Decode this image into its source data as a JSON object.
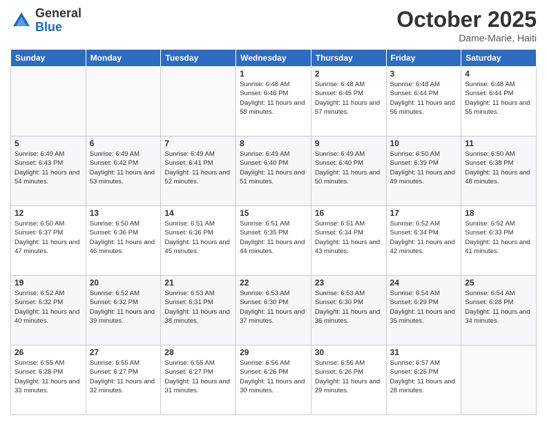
{
  "header": {
    "logo_general": "General",
    "logo_blue": "Blue",
    "month_title": "October 2025",
    "location": "Dame-Marie, Haiti"
  },
  "weekdays": [
    "Sunday",
    "Monday",
    "Tuesday",
    "Wednesday",
    "Thursday",
    "Friday",
    "Saturday"
  ],
  "weeks": [
    [
      {
        "day": "",
        "info": ""
      },
      {
        "day": "",
        "info": ""
      },
      {
        "day": "",
        "info": ""
      },
      {
        "day": "1",
        "info": "Sunrise: 6:48 AM\nSunset: 6:46 PM\nDaylight: 11 hours\nand 58 minutes."
      },
      {
        "day": "2",
        "info": "Sunrise: 6:48 AM\nSunset: 6:45 PM\nDaylight: 11 hours\nand 57 minutes."
      },
      {
        "day": "3",
        "info": "Sunrise: 6:48 AM\nSunset: 6:44 PM\nDaylight: 11 hours\nand 56 minutes."
      },
      {
        "day": "4",
        "info": "Sunrise: 6:48 AM\nSunset: 6:44 PM\nDaylight: 11 hours\nand 55 minutes."
      }
    ],
    [
      {
        "day": "5",
        "info": "Sunrise: 6:49 AM\nSunset: 6:43 PM\nDaylight: 11 hours\nand 54 minutes."
      },
      {
        "day": "6",
        "info": "Sunrise: 6:49 AM\nSunset: 6:42 PM\nDaylight: 11 hours\nand 53 minutes."
      },
      {
        "day": "7",
        "info": "Sunrise: 6:49 AM\nSunset: 6:41 PM\nDaylight: 11 hours\nand 52 minutes."
      },
      {
        "day": "8",
        "info": "Sunrise: 6:49 AM\nSunset: 6:40 PM\nDaylight: 11 hours\nand 51 minutes."
      },
      {
        "day": "9",
        "info": "Sunrise: 6:49 AM\nSunset: 6:40 PM\nDaylight: 11 hours\nand 50 minutes."
      },
      {
        "day": "10",
        "info": "Sunrise: 6:50 AM\nSunset: 6:39 PM\nDaylight: 11 hours\nand 49 minutes."
      },
      {
        "day": "11",
        "info": "Sunrise: 6:50 AM\nSunset: 6:38 PM\nDaylight: 11 hours\nand 48 minutes."
      }
    ],
    [
      {
        "day": "12",
        "info": "Sunrise: 6:50 AM\nSunset: 6:37 PM\nDaylight: 11 hours\nand 47 minutes."
      },
      {
        "day": "13",
        "info": "Sunrise: 6:50 AM\nSunset: 6:36 PM\nDaylight: 11 hours\nand 46 minutes."
      },
      {
        "day": "14",
        "info": "Sunrise: 6:51 AM\nSunset: 6:36 PM\nDaylight: 11 hours\nand 45 minutes."
      },
      {
        "day": "15",
        "info": "Sunrise: 6:51 AM\nSunset: 6:35 PM\nDaylight: 11 hours\nand 44 minutes."
      },
      {
        "day": "16",
        "info": "Sunrise: 6:51 AM\nSunset: 6:34 PM\nDaylight: 11 hours\nand 43 minutes."
      },
      {
        "day": "17",
        "info": "Sunrise: 6:52 AM\nSunset: 6:34 PM\nDaylight: 11 hours\nand 42 minutes."
      },
      {
        "day": "18",
        "info": "Sunrise: 6:52 AM\nSunset: 6:33 PM\nDaylight: 11 hours\nand 41 minutes."
      }
    ],
    [
      {
        "day": "19",
        "info": "Sunrise: 6:52 AM\nSunset: 6:32 PM\nDaylight: 11 hours\nand 40 minutes."
      },
      {
        "day": "20",
        "info": "Sunrise: 6:52 AM\nSunset: 6:32 PM\nDaylight: 11 hours\nand 39 minutes."
      },
      {
        "day": "21",
        "info": "Sunrise: 6:53 AM\nSunset: 6:31 PM\nDaylight: 11 hours\nand 38 minutes."
      },
      {
        "day": "22",
        "info": "Sunrise: 6:53 AM\nSunset: 6:30 PM\nDaylight: 11 hours\nand 37 minutes."
      },
      {
        "day": "23",
        "info": "Sunrise: 6:53 AM\nSunset: 6:30 PM\nDaylight: 11 hours\nand 36 minutes."
      },
      {
        "day": "24",
        "info": "Sunrise: 6:54 AM\nSunset: 6:29 PM\nDaylight: 11 hours\nand 35 minutes."
      },
      {
        "day": "25",
        "info": "Sunrise: 6:54 AM\nSunset: 6:28 PM\nDaylight: 11 hours\nand 34 minutes."
      }
    ],
    [
      {
        "day": "26",
        "info": "Sunrise: 6:55 AM\nSunset: 6:28 PM\nDaylight: 11 hours\nand 33 minutes."
      },
      {
        "day": "27",
        "info": "Sunrise: 6:55 AM\nSunset: 6:27 PM\nDaylight: 11 hours\nand 32 minutes."
      },
      {
        "day": "28",
        "info": "Sunrise: 6:55 AM\nSunset: 6:27 PM\nDaylight: 11 hours\nand 31 minutes."
      },
      {
        "day": "29",
        "info": "Sunrise: 6:56 AM\nSunset: 6:26 PM\nDaylight: 11 hours\nand 30 minutes."
      },
      {
        "day": "30",
        "info": "Sunrise: 6:56 AM\nSunset: 6:26 PM\nDaylight: 11 hours\nand 29 minutes."
      },
      {
        "day": "31",
        "info": "Sunrise: 6:57 AM\nSunset: 6:25 PM\nDaylight: 11 hours\nand 28 minutes."
      },
      {
        "day": "",
        "info": ""
      }
    ]
  ]
}
